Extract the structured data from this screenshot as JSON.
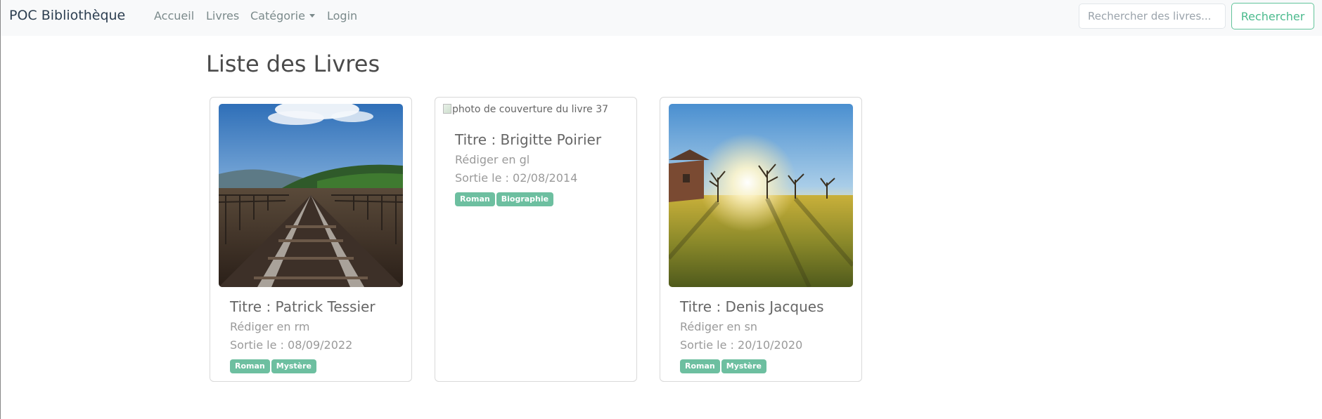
{
  "navbar": {
    "brand": "POC Bibliothèque",
    "links": [
      {
        "label": "Accueil"
      },
      {
        "label": "Livres"
      },
      {
        "label": "Catégorie"
      },
      {
        "label": "Login"
      }
    ],
    "search": {
      "placeholder": "Rechercher des livres...",
      "value": "",
      "button_label": "Rechercher"
    }
  },
  "page": {
    "title": "Liste des Livres"
  },
  "books": [
    {
      "image": "railway-track-photo",
      "title": "Titre : Patrick Tessier",
      "language": "Rédiger en rm",
      "release": "Sortie le : 08/09/2022",
      "tags": [
        "Roman",
        "Mystère"
      ]
    },
    {
      "image_alt": "photo de couverture du livre 37",
      "title": "Titre : Brigitte Poirier",
      "language": "Rédiger en gl",
      "release": "Sortie le : 02/08/2014",
      "tags": [
        "Roman",
        "Biographie"
      ]
    },
    {
      "image": "sunset-meadow-photo",
      "title": "Titre : Denis Jacques",
      "language": "Rédiger en sn",
      "release": "Sortie le : 20/10/2020",
      "tags": [
        "Roman",
        "Mystère"
      ]
    }
  ],
  "colors": {
    "accent": "#4cbb8e",
    "badge": "#6dbfa0",
    "navbar_bg": "#f8f9fa"
  }
}
